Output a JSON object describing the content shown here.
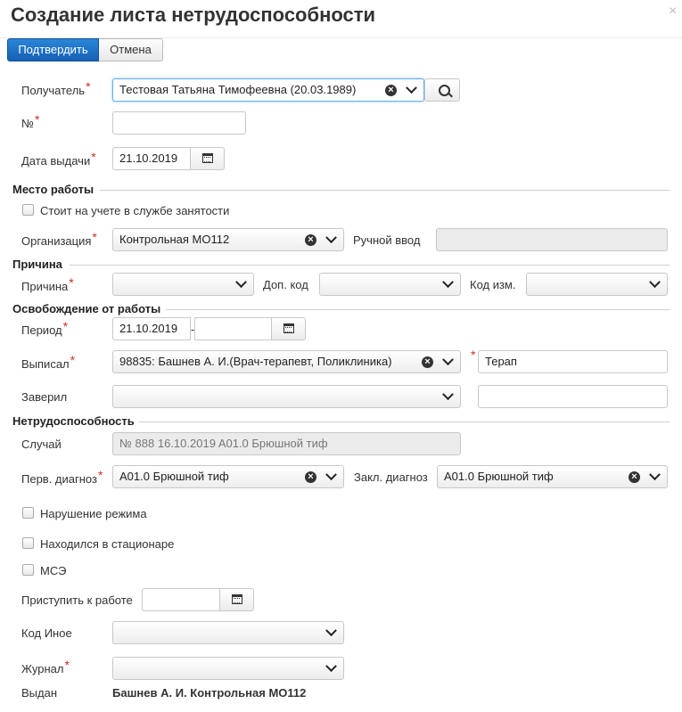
{
  "header": {
    "title": "Создание листа нетрудоспособности",
    "close": "×"
  },
  "toolbar": {
    "confirm_label": "Подтвердить",
    "cancel_label": "Отмена"
  },
  "form": {
    "recipient": {
      "label": "Получатель",
      "value": "Тестовая Татьяна Тимофеевна (20.03.1989)"
    },
    "number": {
      "label": "№",
      "value": ""
    },
    "issue_date": {
      "label": "Дата выдачи",
      "value": "21.10.2019"
    },
    "workplace": {
      "section": "Место работы",
      "employment_checkbox": "Стоит на учете в службе занятости",
      "organization": {
        "label": "Организация",
        "value": "Контрольная МО112"
      },
      "manual_input": {
        "label": "Ручной ввод",
        "value": ""
      }
    },
    "reason": {
      "section": "Причина",
      "reason": {
        "label": "Причина",
        "value": ""
      },
      "extra_code": {
        "label": "Доп. код",
        "value": ""
      },
      "change_code": {
        "label": "Код изм.",
        "value": ""
      }
    },
    "release": {
      "section": "Освобождение от работы",
      "period": {
        "label": "Период",
        "from": "21.10.2019",
        "sep": "-",
        "to": ""
      },
      "issued_by": {
        "label": "Выписал",
        "value": "98835: Башнев А. И.(Врач-терапевт, Поликлиника)",
        "specialty": "Терап"
      },
      "certified": {
        "label": "Заверил",
        "value": "",
        "extra": ""
      }
    },
    "disability": {
      "section": "Нетрудоспособность",
      "case": {
        "label": "Случай",
        "value": "№ 888 16.10.2019 A01.0 Брюшной тиф"
      },
      "first_diag": {
        "label": "Перв. диагноз",
        "value": "A01.0 Брюшной тиф"
      },
      "final_diag": {
        "label": "Закл. диагноз",
        "value": "A01.0 Брюшной тиф"
      },
      "regime_violation": "Нарушение режима",
      "hospital": "Находился в стационаре",
      "mse": "МСЭ",
      "return_date": {
        "label": "Приступить к работе",
        "value": ""
      },
      "other_code": {
        "label": "Код Иное",
        "value": ""
      },
      "journal": {
        "label": "Журнал",
        "value": ""
      },
      "issued": {
        "label": "Выдан",
        "value": "Башнев А. И. Контрольная МО112"
      }
    },
    "required_mark": "*"
  },
  "colors": {
    "primary": "#1b6ec2",
    "required": "#c9302c",
    "focus": "#66afe9"
  }
}
